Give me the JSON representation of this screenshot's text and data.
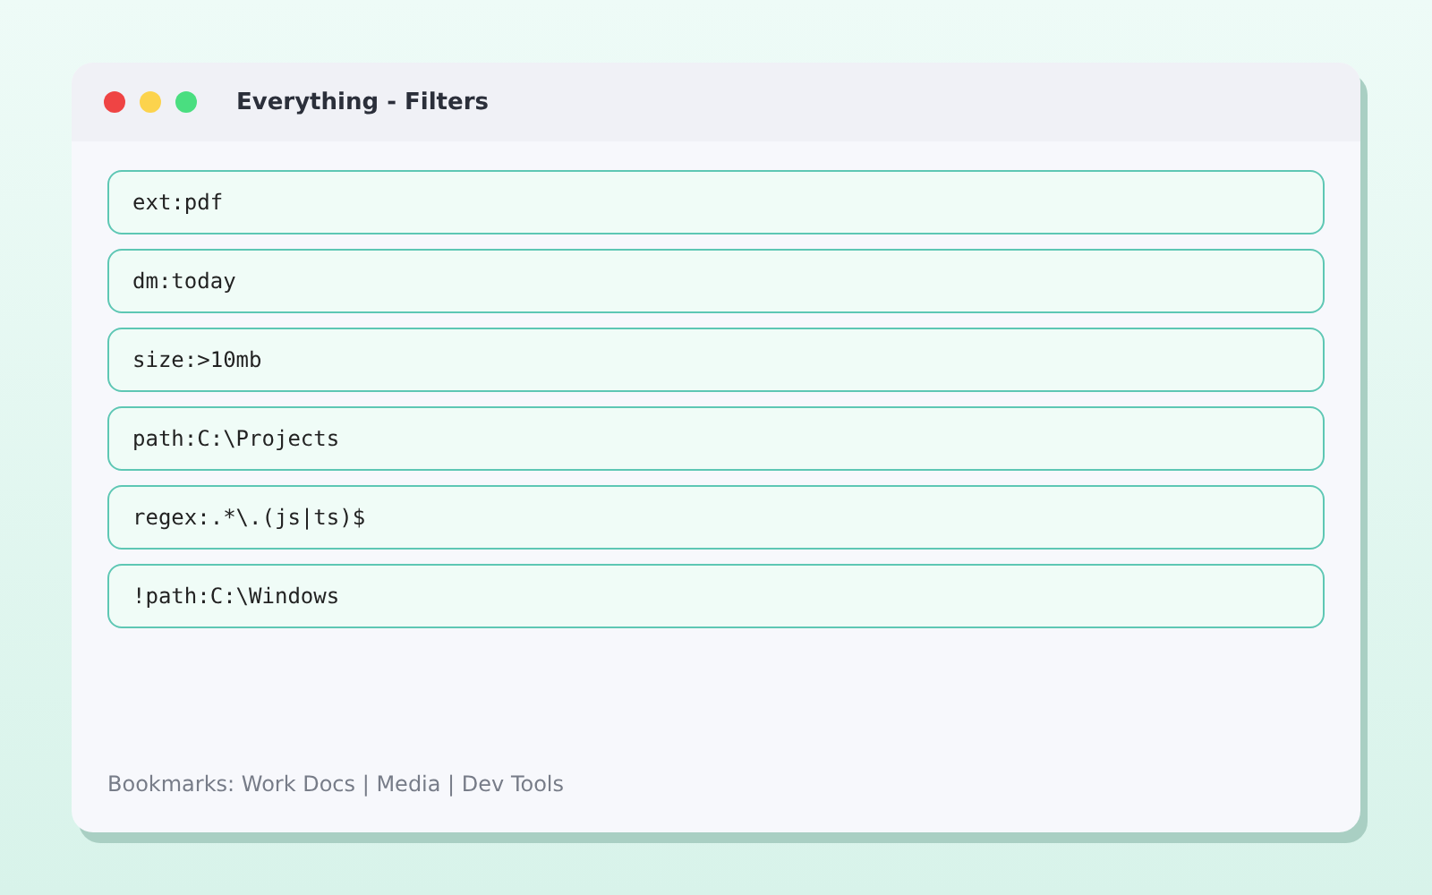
{
  "window": {
    "title": "Everything - Filters"
  },
  "filters": [
    "ext:pdf",
    "dm:today",
    "size:>10mb",
    "path:C:\\Projects",
    "regex:.*\\.(js|ts)$",
    "!path:C:\\Windows"
  ],
  "footer": "Bookmarks: Work Docs | Media | Dev Tools"
}
